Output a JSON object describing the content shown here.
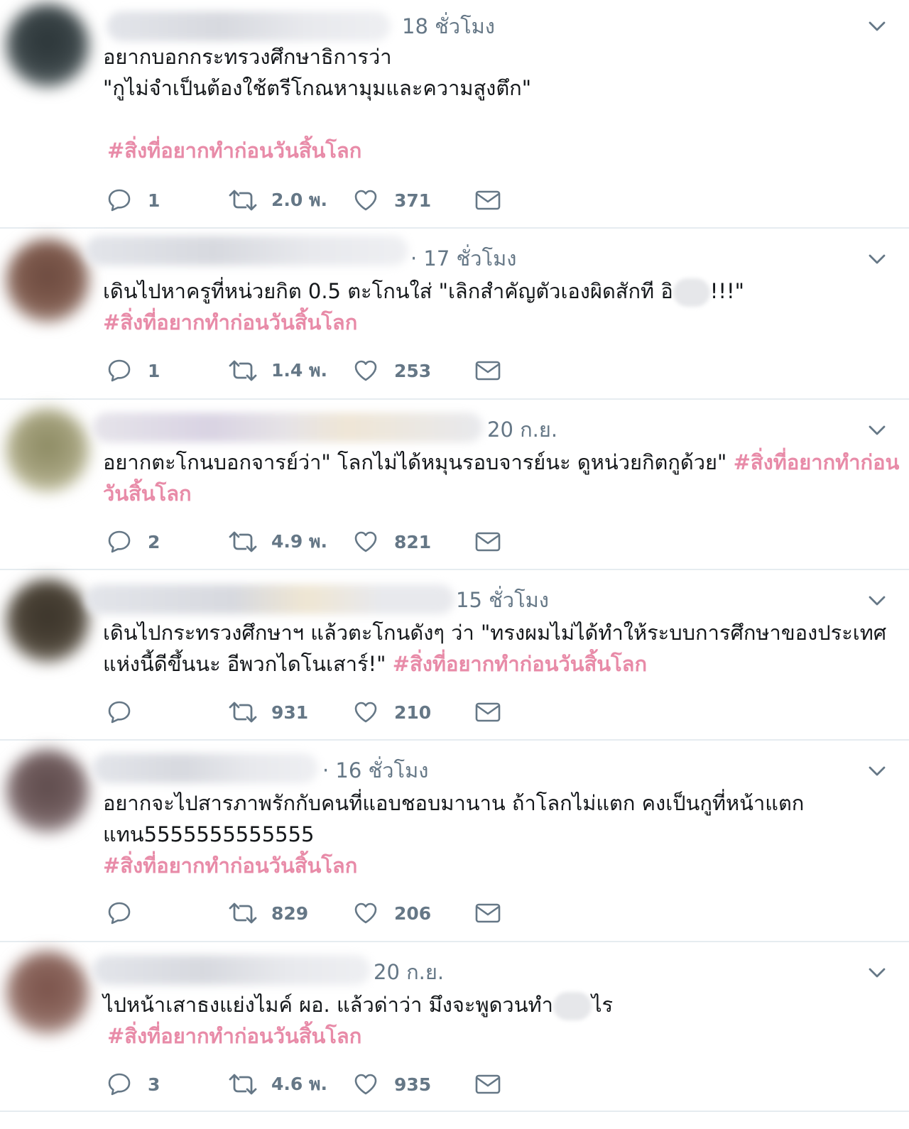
{
  "colors": {
    "hashtag": "#e88ba8",
    "meta": "#657786",
    "text": "#14171a",
    "divider": "#e6ecf0"
  },
  "icons": {
    "reply": "speech-bubble-icon",
    "retweet": "retweet-arrows-icon",
    "like": "heart-icon",
    "dm": "envelope-icon",
    "menu": "chevron-down-icon"
  },
  "tweets": [
    {
      "time": "18 ชั่วโมง",
      "lines": [
        "อยากบอกกระทรวงศึกษาธิการว่า",
        "\"กูไม่จำเป็นต้องใช้ตรีโกณหามุมและความสูงตึก\""
      ],
      "hashtag": "#สิ่งที่อยากทำก่อนวันสิ้นโลก",
      "replies": "1",
      "retweets": "2.0 พ.",
      "likes": "371"
    },
    {
      "time": "· 17 ชั่วโมง",
      "line1_a": "เดินไปหาครูที่หน่วยกิต 0.5 ตะโกนใส่ \"เลิกสำคัญตัวเองผิดสักที อิ",
      "line1_b": "!!!\"",
      "hashtag": "#สิ่งที่อยากทำก่อนวันสิ้นโลก",
      "replies": "1",
      "retweets": "1.4 พ.",
      "likes": "253"
    },
    {
      "time": "20 ก.ย.",
      "line1_text": "อยากตะโกนบอกจารย์ว่า\" โลกไม่ได้หมุนรอบจารย์นะ ดูหน่วยกิตกูด้วย\" ",
      "line1_tag": "#สิ่งที่อยากทำก่อน",
      "line2_tag": "วันสิ้นโลก",
      "replies": "2",
      "retweets": "4.9 พ.",
      "likes": "821"
    },
    {
      "time": "15 ชั่วโมง",
      "line1": "เดินไปกระทรวงศึกษาฯ แล้วตะโกนดังๆ ว่า \"ทรงผมไม่ได้ทำให้ระบบการศึกษาของประเทศ",
      "line2_text": "แห่งนี้ดีขึ้นนะ อีพวกไดโนเสาร์!\" ",
      "hashtag": "#สิ่งที่อยากทำก่อนวันสิ้นโลก",
      "replies": "",
      "retweets": "931",
      "likes": "210"
    },
    {
      "time": "· 16 ชั่วโมง",
      "lines": [
        "อยากจะไปสารภาพรักกับคนที่แอบชอบมานาน ถ้าโลกไม่แตก คงเป็นกูที่หน้าแตก",
        "แทน5555555555555"
      ],
      "hashtag": "#สิ่งที่อยากทำก่อนวันสิ้นโลก",
      "replies": "",
      "retweets": "829",
      "likes": "206"
    },
    {
      "time": "20 ก.ย.",
      "line1_a": "ไปหน้าเสาธงแย่งไมค์ ผอ. แล้วด่าว่า มึงจะพูดวนทำ",
      "line1_b": "ไร",
      "hashtag": "#สิ่งที่อยากทำก่อนวันสิ้นโลก",
      "replies": "3",
      "retweets": "4.6 พ.",
      "likes": "935"
    }
  ]
}
